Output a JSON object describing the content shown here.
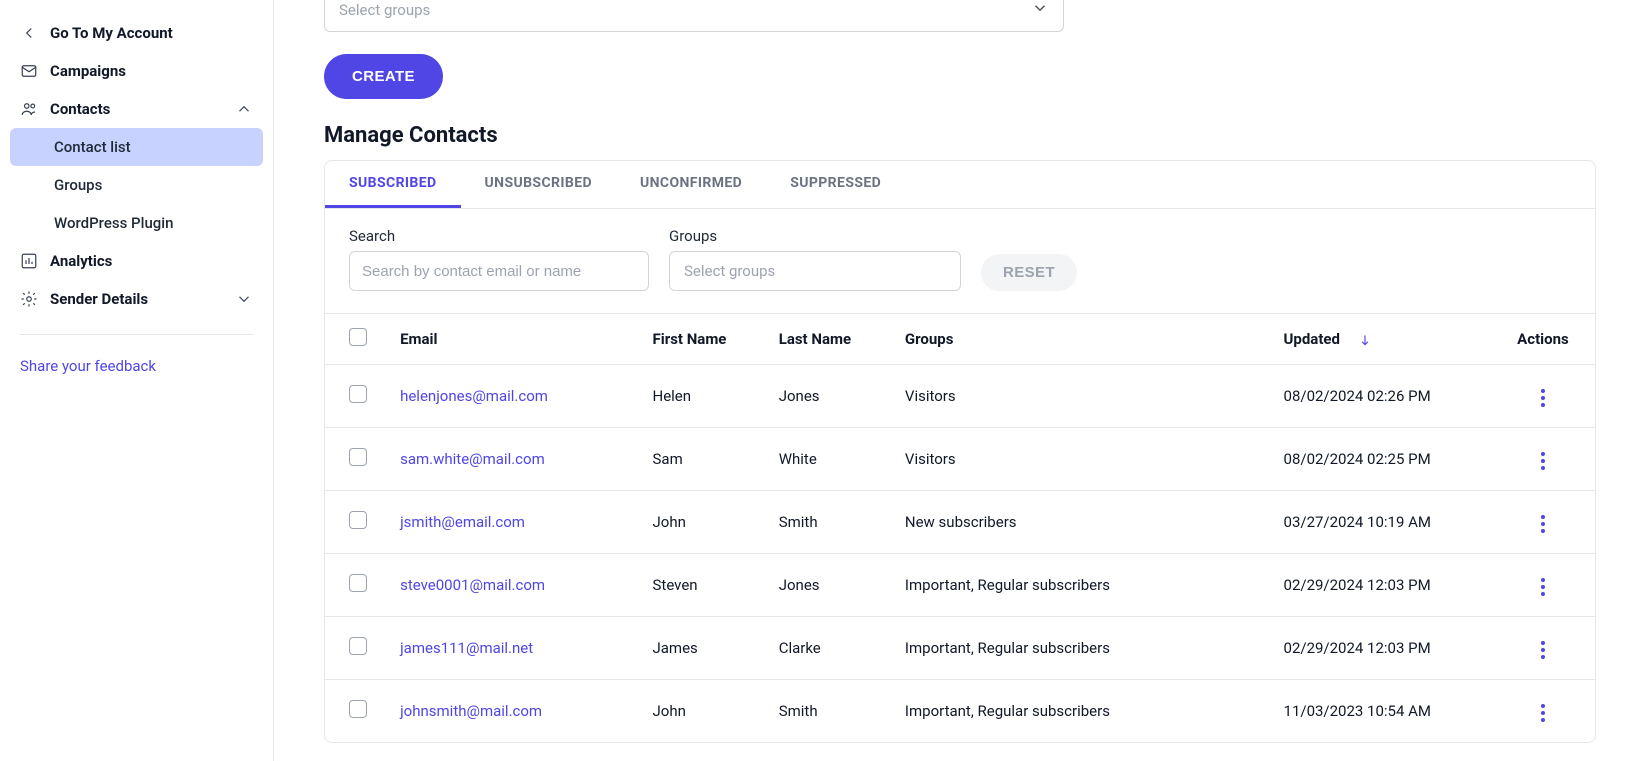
{
  "sidebar": {
    "go_to_account": "Go To My Account",
    "campaigns": "Campaigns",
    "contacts": "Contacts",
    "contact_list": "Contact list",
    "groups": "Groups",
    "wordpress_plugin": "WordPress Plugin",
    "analytics": "Analytics",
    "sender_details": "Sender Details",
    "feedback": "Share your feedback"
  },
  "top_form": {
    "select_groups_placeholder": "Select groups",
    "create_button": "CREATE"
  },
  "manage": {
    "title": "Manage Contacts",
    "tabs": {
      "subscribed": "SUBSCRIBED",
      "unsubscribed": "UNSUBSCRIBED",
      "unconfirmed": "UNCONFIRMED",
      "suppressed": "SUPPRESSED"
    },
    "filters": {
      "search_label": "Search",
      "search_placeholder": "Search by contact email or name",
      "groups_label": "Groups",
      "groups_placeholder": "Select groups",
      "reset": "RESET"
    },
    "columns": {
      "email": "Email",
      "first_name": "First Name",
      "last_name": "Last Name",
      "groups": "Groups",
      "updated": "Updated",
      "actions": "Actions"
    },
    "rows": [
      {
        "email": "helenjones@mail.com",
        "first": "Helen",
        "last": "Jones",
        "groups": "Visitors",
        "updated": "08/02/2024 02:26 PM"
      },
      {
        "email": "sam.white@mail.com",
        "first": "Sam",
        "last": "White",
        "groups": "Visitors",
        "updated": "08/02/2024 02:25 PM"
      },
      {
        "email": "jsmith@email.com",
        "first": "John",
        "last": "Smith",
        "groups": "New subscribers",
        "updated": "03/27/2024 10:19 AM"
      },
      {
        "email": "steve0001@mail.com",
        "first": "Steven",
        "last": "Jones",
        "groups": "Important, Regular subscribers",
        "updated": "02/29/2024 12:03 PM"
      },
      {
        "email": "james111@mail.net",
        "first": "James",
        "last": "Clarke",
        "groups": "Important, Regular subscribers",
        "updated": "02/29/2024 12:03 PM"
      },
      {
        "email": "johnsmith@mail.com",
        "first": "John",
        "last": "Smith",
        "groups": "Important, Regular subscribers",
        "updated": "11/03/2023 10:54 AM"
      }
    ]
  }
}
